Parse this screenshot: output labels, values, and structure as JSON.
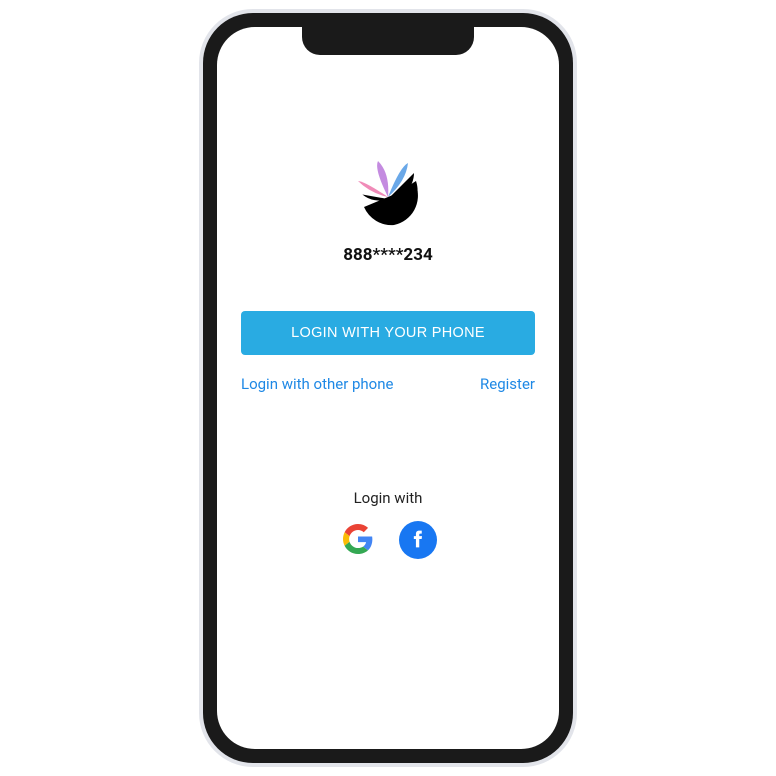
{
  "phone_number_masked": "888****234",
  "primary_button_label": "LOGIN WITH YOUR PHONE",
  "link_other_phone": "Login with other phone",
  "link_register": "Register",
  "login_with_label": "Login with",
  "social": {
    "google": "Google",
    "facebook": "Facebook"
  },
  "colors": {
    "primary": "#29abe2",
    "link": "#1e88e5",
    "facebook": "#1877f2"
  }
}
